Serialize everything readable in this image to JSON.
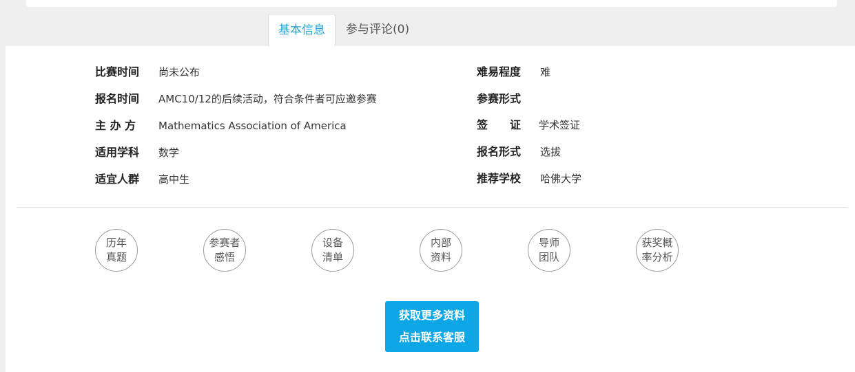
{
  "tabs": [
    {
      "label": "基本信息",
      "active": true
    },
    {
      "label": "参与评论(0)",
      "active": false
    }
  ],
  "info_left": [
    {
      "label": "比赛时间",
      "value": "尚未公布"
    },
    {
      "label": "报名时间",
      "value": "AMC10/12的后续活动，符合条件者可应邀参赛"
    },
    {
      "label": "主 办 方",
      "value": "Mathematics Association of America"
    },
    {
      "label": "适用学科",
      "value": "数学"
    },
    {
      "label": "适宜人群",
      "value": "高中生"
    }
  ],
  "info_right": [
    {
      "label": "难易程度",
      "value": "难"
    },
    {
      "label": "参赛形式",
      "value": ""
    },
    {
      "label": "签　　证",
      "value": "学术签证"
    },
    {
      "label": "报名形式",
      "value": "选拔"
    },
    {
      "label": "推荐学校",
      "value": "哈佛大学"
    }
  ],
  "resources": [
    {
      "label": "历年\n真题"
    },
    {
      "label": "参赛者\n感悟"
    },
    {
      "label": "设备\n清单"
    },
    {
      "label": "内部\n资料"
    },
    {
      "label": "导师\n团队"
    },
    {
      "label": "获奖概\n率分析"
    }
  ],
  "cta": {
    "line1": "获取更多资料",
    "line2": "点击联系客服"
  },
  "colors": {
    "accent": "#1aa3d8",
    "button": "#0ea7e6",
    "background": "#efefef"
  }
}
